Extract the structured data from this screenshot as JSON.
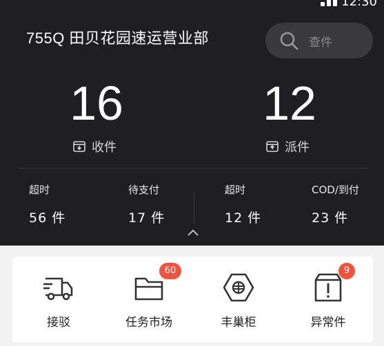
{
  "status_bar": {
    "time": "12:30"
  },
  "header": {
    "title": "755Q 田贝花园速运营业部"
  },
  "search": {
    "label": "查件"
  },
  "stats": {
    "received": {
      "count": "16",
      "label": "收件"
    },
    "dispatched": {
      "count": "12",
      "label": "派件"
    }
  },
  "sub_stats": [
    {
      "label": "超时",
      "value": "56 件"
    },
    {
      "label": "待支付",
      "value": "17 件"
    },
    {
      "label": "超时",
      "value": "12 件"
    },
    {
      "label": "COD/到付",
      "value": "23 件"
    }
  ],
  "tools": [
    {
      "label": "接驳",
      "icon": "truck-icon",
      "badge": ""
    },
    {
      "label": "任务市场",
      "icon": "folder-icon",
      "badge": "60"
    },
    {
      "label": "丰巢柜",
      "icon": "locker-icon",
      "badge": ""
    },
    {
      "label": "异常件",
      "icon": "exception-box-icon",
      "badge": "9"
    }
  ],
  "colors": {
    "dark_bg": "#1f1f21",
    "badge": "#f0533f",
    "search_bg": "#3a3a3d"
  }
}
